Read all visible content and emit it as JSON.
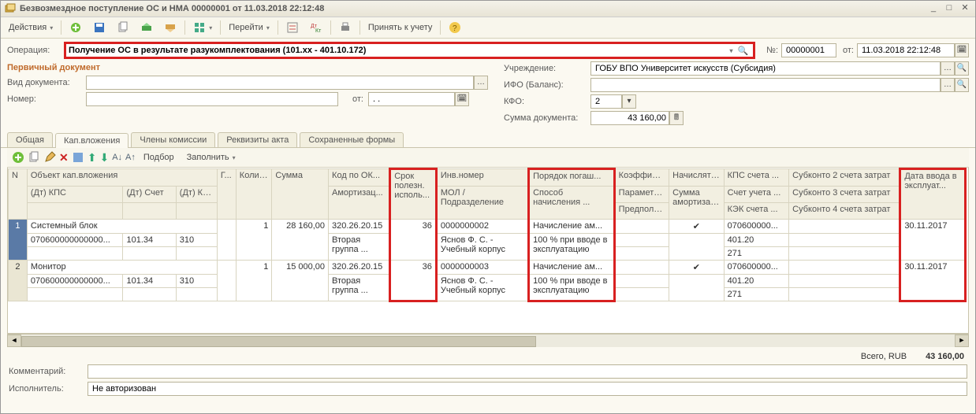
{
  "window": {
    "title": "Безвозмездное поступление ОС и НМА 00000001 от 11.03.2018 22:12:48"
  },
  "commandbar": {
    "actions": "Действия",
    "go": "Перейти",
    "accept": "Принять к учету"
  },
  "header": {
    "operation_lbl": "Операция:",
    "operation": "Получение ОС в результате разукомплектования (101.xx - 401.10.172)",
    "num_lbl": "№:",
    "num": "00000001",
    "from_lbl": "от:",
    "date": "11.03.2018 22:12:48",
    "primary_doc": "Первичный документ",
    "doc_type_lbl": "Вид документа:",
    "numrow_lbl": "Номер:",
    "numrow_from": "от:",
    "numrow_date": ". .",
    "org_lbl": "Учреждение:",
    "org": "ГОБУ ВПО Университет искусств (Субсидия)",
    "ifo_lbl": "ИФО (Баланс):",
    "kfo_lbl": "КФО:",
    "kfo": "2",
    "sum_lbl": "Сумма документа:",
    "sum": "43 160,00"
  },
  "tabs": [
    "Общая",
    "Кап.вложения",
    "Члены комиссии",
    "Реквизиты акта",
    "Сохраненные формы"
  ],
  "grid_toolbar": {
    "select": "Подбор",
    "fill": "Заполнить"
  },
  "grid": {
    "h1": {
      "n": "N",
      "obj": "Объект кап.вложения",
      "gu": "Г...",
      "qty": "Колич...",
      "sum": "Сумма",
      "okof": "Код по ОК...",
      "srok": "Срок полезн. исполь...",
      "inv": "Инв.номер",
      "por": "Порядок погаш...",
      "koef": "Коэффици...",
      "nach": "Начислять ...",
      "kps": "КПС счета ...",
      "sub2": "Субконто 2 счета затрат",
      "date": "Дата ввода в эксплуат..."
    },
    "h2": {
      "kps_dt": "(Дт) КПС",
      "acc_dt": "(Дт) Счет",
      "kek_dt": "(Дт) КЭК",
      "amort": "Амортизац...",
      "mol": "МОЛ / Подразделение",
      "sposob": "Способ начисления ...",
      "param": "Параметр ...",
      "sumam": "Сумма амортизации",
      "acc": "Счет учета ...",
      "sub3": "Субконто 3 счета затрат"
    },
    "h3": {
      "pred": "Предполаг...",
      "kek": "КЭК счета ...",
      "sub4": "Субконто 4 счета затрат"
    },
    "rows": [
      {
        "n": "1",
        "obj": "Системный блок",
        "okof": "320.26.20.15",
        "srok": "36",
        "inv": "0000000002",
        "por": "Начисление ам...",
        "kps": "070600000...",
        "date": "30.11.2017",
        "kps_dt": "070600000000000...",
        "acc_dt": "101.34",
        "kek_dt": "310",
        "amort": "Вторая группа ...",
        "mol": "Яснов Ф. С. - Учебный корпус",
        "sposob": "100 % при вводе в эксплуатацию",
        "acc": "401.20",
        "kek_acc": "271",
        "qty": "1",
        "sum": "28 160,00",
        "nach": "✔"
      },
      {
        "n": "2",
        "obj": "Монитор",
        "okof": "320.26.20.15",
        "srok": "36",
        "inv": "0000000003",
        "por": "Начисление ам...",
        "kps": "070600000...",
        "date": "30.11.2017",
        "kps_dt": "070600000000000...",
        "acc_dt": "101.34",
        "kek_dt": "310",
        "amort": "Вторая группа ...",
        "mol": "Яснов Ф. С. - Учебный корпус",
        "sposob": "100 % при вводе в эксплуатацию",
        "acc": "401.20",
        "kek_acc": "271",
        "qty": "1",
        "sum": "15 000,00",
        "nach": "✔"
      }
    ]
  },
  "totals": {
    "lbl": "Всего, RUB",
    "val": "43 160,00"
  },
  "footer": {
    "comment_lbl": "Комментарий:",
    "exec_lbl": "Исполнитель:",
    "exec": "Не авторизован"
  }
}
